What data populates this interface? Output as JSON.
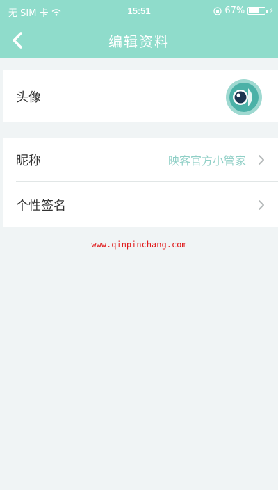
{
  "status_bar": {
    "carrier": "无 SIM 卡",
    "time": "15:51",
    "battery": "67%",
    "battery_level": 0.67
  },
  "nav": {
    "title": "编辑资料",
    "back_icon": "chevron-left-icon"
  },
  "profile": {
    "avatar_label": "头像",
    "nickname_label": "昵称",
    "nickname_value": "映客官方小管家",
    "signature_label": "个性签名",
    "signature_value": ""
  },
  "watermark": "www.qinpinchang.com",
  "colors": {
    "accent": "#8fdccb",
    "value_text": "#8fcfc6",
    "watermark": "#e0191a"
  }
}
